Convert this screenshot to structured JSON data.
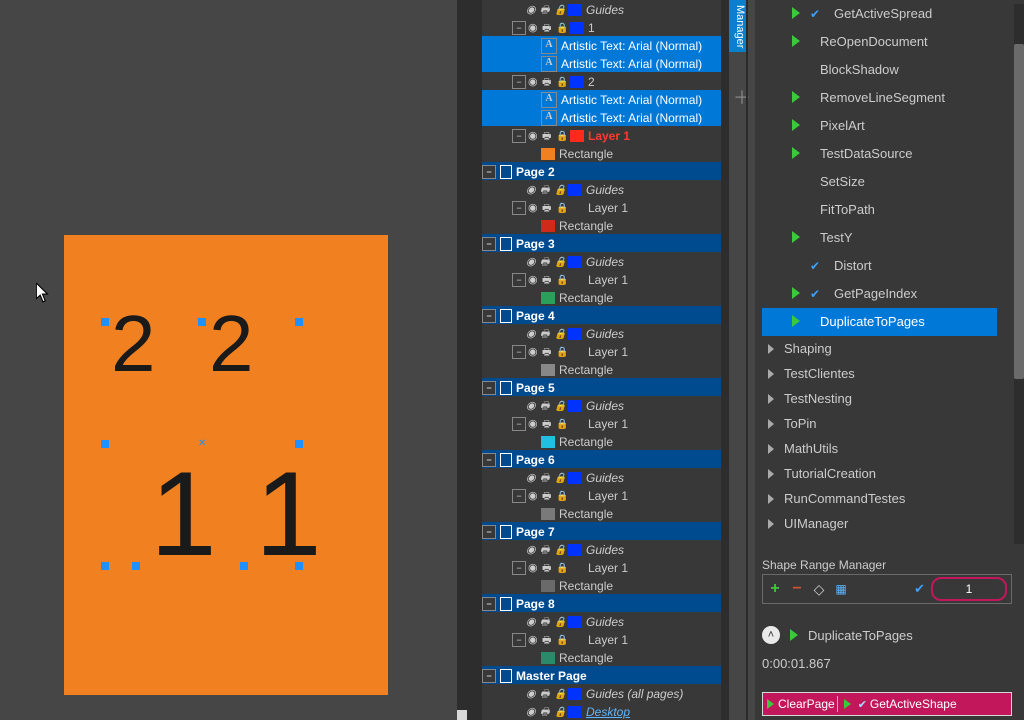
{
  "canvas": {
    "t2a": "2",
    "t2b": "2",
    "t1a": "1",
    "t1b": "1"
  },
  "layers": [
    {
      "type": "guides",
      "indent": 2,
      "label": "Guides",
      "swatch": "#0033ff"
    },
    {
      "type": "layer",
      "indent": 2,
      "label": "1",
      "swatch": "#0033ff",
      "expanded": true,
      "sel": false
    },
    {
      "type": "obj-text",
      "indent": 3,
      "label": "Artistic Text: Arial (Normal)",
      "sel": true
    },
    {
      "type": "obj-text",
      "indent": 3,
      "label": "Artistic Text: Arial (Normal)",
      "sel": true
    },
    {
      "type": "layer",
      "indent": 2,
      "label": "2",
      "swatch": "#0033ff",
      "expanded": true,
      "sel": false
    },
    {
      "type": "obj-text",
      "indent": 3,
      "label": "Artistic Text: Arial (Normal)",
      "sel": true
    },
    {
      "type": "obj-text",
      "indent": 3,
      "label": "Artistic Text: Arial (Normal)",
      "sel": true
    },
    {
      "type": "layer-red",
      "indent": 2,
      "label": "Layer 1",
      "swatch": "#ff2a1a",
      "expanded": true
    },
    {
      "type": "obj-rect",
      "indent": 3,
      "label": "Rectangle",
      "swatch": "#f08020"
    },
    {
      "type": "page",
      "indent": 0,
      "label": "Page 2"
    },
    {
      "type": "guides",
      "indent": 2,
      "label": "Guides",
      "swatch": "#0033ff"
    },
    {
      "type": "layer",
      "indent": 2,
      "label": "Layer 1",
      "expanded": true
    },
    {
      "type": "obj-rect",
      "indent": 3,
      "label": "Rectangle",
      "swatch": "#d02a1a"
    },
    {
      "type": "page",
      "indent": 0,
      "label": "Page 3"
    },
    {
      "type": "guides",
      "indent": 2,
      "label": "Guides",
      "swatch": "#0033ff"
    },
    {
      "type": "layer",
      "indent": 2,
      "label": "Layer 1",
      "expanded": true
    },
    {
      "type": "obj-rect",
      "indent": 3,
      "label": "Rectangle",
      "swatch": "#2aa05a"
    },
    {
      "type": "page",
      "indent": 0,
      "label": "Page 4"
    },
    {
      "type": "guides",
      "indent": 2,
      "label": "Guides",
      "swatch": "#0033ff"
    },
    {
      "type": "layer",
      "indent": 2,
      "label": "Layer 1",
      "expanded": true
    },
    {
      "type": "obj-rect",
      "indent": 3,
      "label": "Rectangle",
      "swatch": "#888888"
    },
    {
      "type": "page",
      "indent": 0,
      "label": "Page 5"
    },
    {
      "type": "guides",
      "indent": 2,
      "label": "Guides",
      "swatch": "#0033ff"
    },
    {
      "type": "layer",
      "indent": 2,
      "label": "Layer 1",
      "expanded": true
    },
    {
      "type": "obj-rect",
      "indent": 3,
      "label": "Rectangle",
      "swatch": "#20c0e0"
    },
    {
      "type": "page",
      "indent": 0,
      "label": "Page 6"
    },
    {
      "type": "guides",
      "indent": 2,
      "label": "Guides",
      "swatch": "#0033ff"
    },
    {
      "type": "layer",
      "indent": 2,
      "label": "Layer 1",
      "expanded": true
    },
    {
      "type": "obj-rect",
      "indent": 3,
      "label": "Rectangle",
      "swatch": "#7a7a7a"
    },
    {
      "type": "page",
      "indent": 0,
      "label": "Page 7"
    },
    {
      "type": "guides",
      "indent": 2,
      "label": "Guides",
      "swatch": "#0033ff"
    },
    {
      "type": "layer",
      "indent": 2,
      "label": "Layer 1",
      "expanded": true
    },
    {
      "type": "obj-rect",
      "indent": 3,
      "label": "Rectangle",
      "swatch": "#6a6a6a"
    },
    {
      "type": "page",
      "indent": 0,
      "label": "Page 8"
    },
    {
      "type": "guides",
      "indent": 2,
      "label": "Guides",
      "swatch": "#0033ff"
    },
    {
      "type": "layer",
      "indent": 2,
      "label": "Layer 1",
      "expanded": true
    },
    {
      "type": "obj-rect",
      "indent": 3,
      "label": "Rectangle",
      "swatch": "#2a8a6a"
    },
    {
      "type": "master",
      "indent": 0,
      "label": "Master Page"
    },
    {
      "type": "guides-all",
      "indent": 2,
      "label": "Guides (all pages)",
      "swatch": "#0033ff"
    },
    {
      "type": "desktop",
      "indent": 2,
      "label": "Desktop",
      "swatch": "#0033ff"
    }
  ],
  "tab_stub": "Manager",
  "commands": [
    {
      "label": "GetActiveSpread",
      "play": true,
      "chk": true
    },
    {
      "label": "ReOpenDocument",
      "play": true,
      "chk": false
    },
    {
      "label": "BlockShadow",
      "play": false,
      "chk": false
    },
    {
      "label": "RemoveLineSegment",
      "play": true,
      "chk": false
    },
    {
      "label": "PixelArt",
      "play": true,
      "chk": false
    },
    {
      "label": "TestDataSource",
      "play": true,
      "chk": false
    },
    {
      "label": "SetSize",
      "play": false,
      "chk": false
    },
    {
      "label": "FitToPath",
      "play": false,
      "chk": false
    },
    {
      "label": "TestY",
      "play": true,
      "chk": false
    },
    {
      "label": "Distort",
      "play": false,
      "chk": true
    },
    {
      "label": "GetPageIndex",
      "play": true,
      "chk": true
    },
    {
      "label": "DuplicateToPages",
      "play": true,
      "chk": false,
      "sel": true
    }
  ],
  "folders": [
    {
      "label": "Shaping"
    },
    {
      "label": "TestClientes"
    },
    {
      "label": "TestNesting"
    },
    {
      "label": "ToPin"
    },
    {
      "label": "MathUtils"
    },
    {
      "label": "TutorialCreation"
    },
    {
      "label": "RunCommandTestes"
    },
    {
      "label": "UIManager"
    }
  ],
  "srm": {
    "title": "Shape Range Manager",
    "value": "1"
  },
  "status": {
    "label": "DuplicateToPages",
    "time": "0:00:01.867"
  },
  "pinkbar": {
    "a": "ClearPage",
    "b": "GetActiveShape"
  }
}
